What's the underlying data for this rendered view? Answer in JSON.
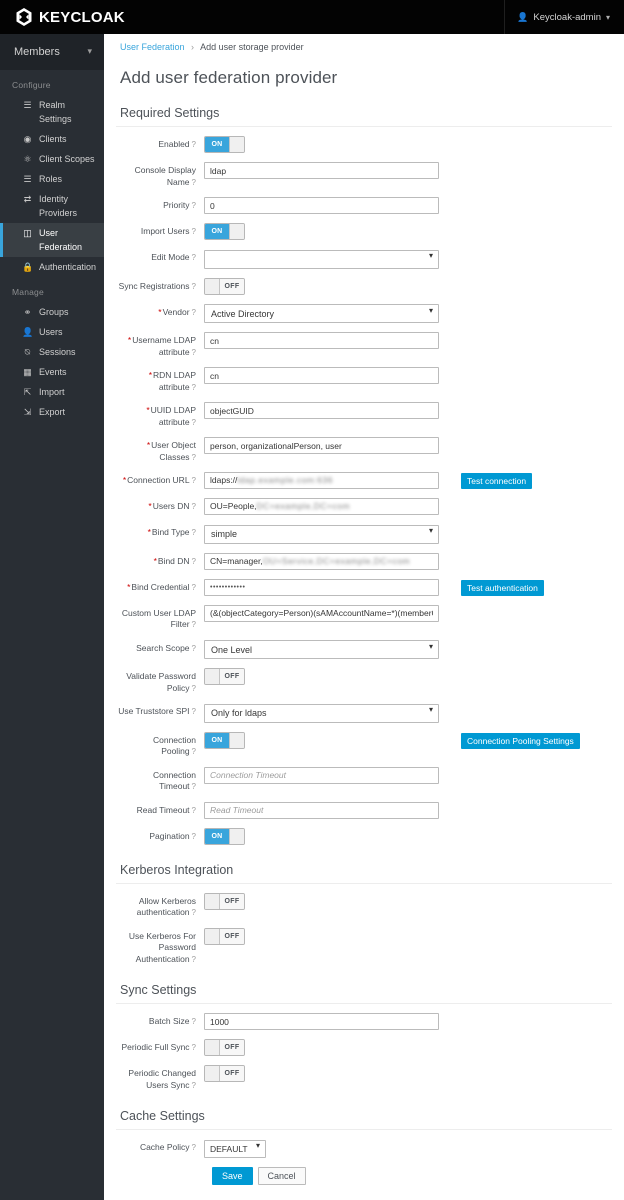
{
  "masthead": {
    "brand": "KEYCLOAK",
    "user": "Keycloak-admin",
    "user_icon": "user-icon",
    "caret_icon": "chevron-down-icon"
  },
  "sidebar": {
    "realm": "Members",
    "realm_caret": "chevron-down-icon",
    "groups": [
      {
        "title": "Configure",
        "items": [
          {
            "label": "Realm Settings",
            "icon": "sliders-icon",
            "active": false
          },
          {
            "label": "Clients",
            "icon": "clients-icon",
            "active": false
          },
          {
            "label": "Client Scopes",
            "icon": "scopes-icon",
            "active": false
          },
          {
            "label": "Roles",
            "icon": "roles-icon",
            "active": false
          },
          {
            "label": "Identity Providers",
            "icon": "identity-providers-icon",
            "active": false
          },
          {
            "label": "User Federation",
            "icon": "database-icon",
            "active": true
          },
          {
            "label": "Authentication",
            "icon": "lock-icon",
            "active": false
          }
        ]
      },
      {
        "title": "Manage",
        "items": [
          {
            "label": "Groups",
            "icon": "groups-icon",
            "active": false
          },
          {
            "label": "Users",
            "icon": "user-icon",
            "active": false
          },
          {
            "label": "Sessions",
            "icon": "clock-icon",
            "active": false
          },
          {
            "label": "Events",
            "icon": "calendar-icon",
            "active": false
          },
          {
            "label": "Import",
            "icon": "import-icon",
            "active": false
          },
          {
            "label": "Export",
            "icon": "export-icon",
            "active": false
          }
        ]
      }
    ]
  },
  "breadcrumb": {
    "parent": "User Federation",
    "separator": "›",
    "current": "Add user storage provider"
  },
  "page": {
    "title": "Add user federation provider"
  },
  "sections": {
    "required": "Required Settings",
    "kerberos": "Kerberos Integration",
    "sync": "Sync Settings",
    "cache": "Cache Settings"
  },
  "fields": {
    "enabled": {
      "label": "Enabled",
      "value": "ON"
    },
    "console_display_name": {
      "label": "Console Display Name",
      "value": "ldap"
    },
    "priority": {
      "label": "Priority",
      "value": "0"
    },
    "import_users": {
      "label": "Import Users",
      "value": "ON"
    },
    "edit_mode": {
      "label": "Edit Mode",
      "value": ""
    },
    "sync_registrations": {
      "label": "Sync Registrations",
      "value": "OFF"
    },
    "vendor": {
      "label": "Vendor",
      "value": "Active Directory"
    },
    "username_ldap_attribute": {
      "label": "Username LDAP attribute",
      "value": "cn"
    },
    "rdn_ldap_attribute": {
      "label": "RDN LDAP attribute",
      "value": "cn"
    },
    "uuid_ldap_attribute": {
      "label": "UUID LDAP attribute",
      "value": "objectGUID"
    },
    "user_object_classes": {
      "label": "User Object Classes",
      "value": "person, organizationalPerson, user"
    },
    "connection_url": {
      "label": "Connection URL",
      "value": "ldaps://",
      "redacted": "ldap.example.com:636"
    },
    "users_dn": {
      "label": "Users DN",
      "value": "OU=People,",
      "redacted": "DC=example,DC=com"
    },
    "bind_type": {
      "label": "Bind Type",
      "value": "simple"
    },
    "bind_dn": {
      "label": "Bind DN",
      "value": "CN=manager,",
      "redacted": "OU=Service,DC=example,DC=com"
    },
    "bind_credential": {
      "label": "Bind Credential",
      "value": "••••••••••••"
    },
    "custom_user_ldap_filter": {
      "label": "Custom User LDAP Filter",
      "value": "(&(objectCategory=Person)(sAMAccountName=*)(memberOf=CN="
    },
    "search_scope": {
      "label": "Search Scope",
      "value": "One Level"
    },
    "validate_password_policy": {
      "label": "Validate Password Policy",
      "value": "OFF"
    },
    "use_truststore_spi": {
      "label": "Use Truststore SPI",
      "value": "Only for ldaps"
    },
    "connection_pooling": {
      "label": "Connection Pooling",
      "value": "ON"
    },
    "connection_timeout": {
      "label": "Connection Timeout",
      "value": "",
      "placeholder": "Connection Timeout"
    },
    "read_timeout": {
      "label": "Read Timeout",
      "value": "",
      "placeholder": "Read Timeout"
    },
    "pagination": {
      "label": "Pagination",
      "value": "ON"
    },
    "allow_kerberos_authentication": {
      "label": "Allow Kerberos authentication",
      "value": "OFF"
    },
    "use_kerberos_for_password_authentication": {
      "label": "Use Kerberos For Password Authentication",
      "value": "OFF"
    },
    "batch_size": {
      "label": "Batch Size",
      "value": "1000"
    },
    "periodic_full_sync": {
      "label": "Periodic Full Sync",
      "value": "OFF"
    },
    "periodic_changed_users_sync": {
      "label": "Periodic Changed Users Sync",
      "value": "OFF"
    },
    "cache_policy": {
      "label": "Cache Policy",
      "value": "DEFAULT"
    }
  },
  "buttons": {
    "test_connection": "Test connection",
    "test_authentication": "Test authentication",
    "connection_pooling_settings": "Connection Pooling Settings",
    "save": "Save",
    "cancel": "Cancel"
  },
  "help_glyph": "?",
  "colors": {
    "accent": "#39a5dc",
    "button_blue": "#0099d3",
    "sidebar_bg": "#292e34",
    "masthead_bg": "#030303",
    "required_star": "#cc0000"
  }
}
